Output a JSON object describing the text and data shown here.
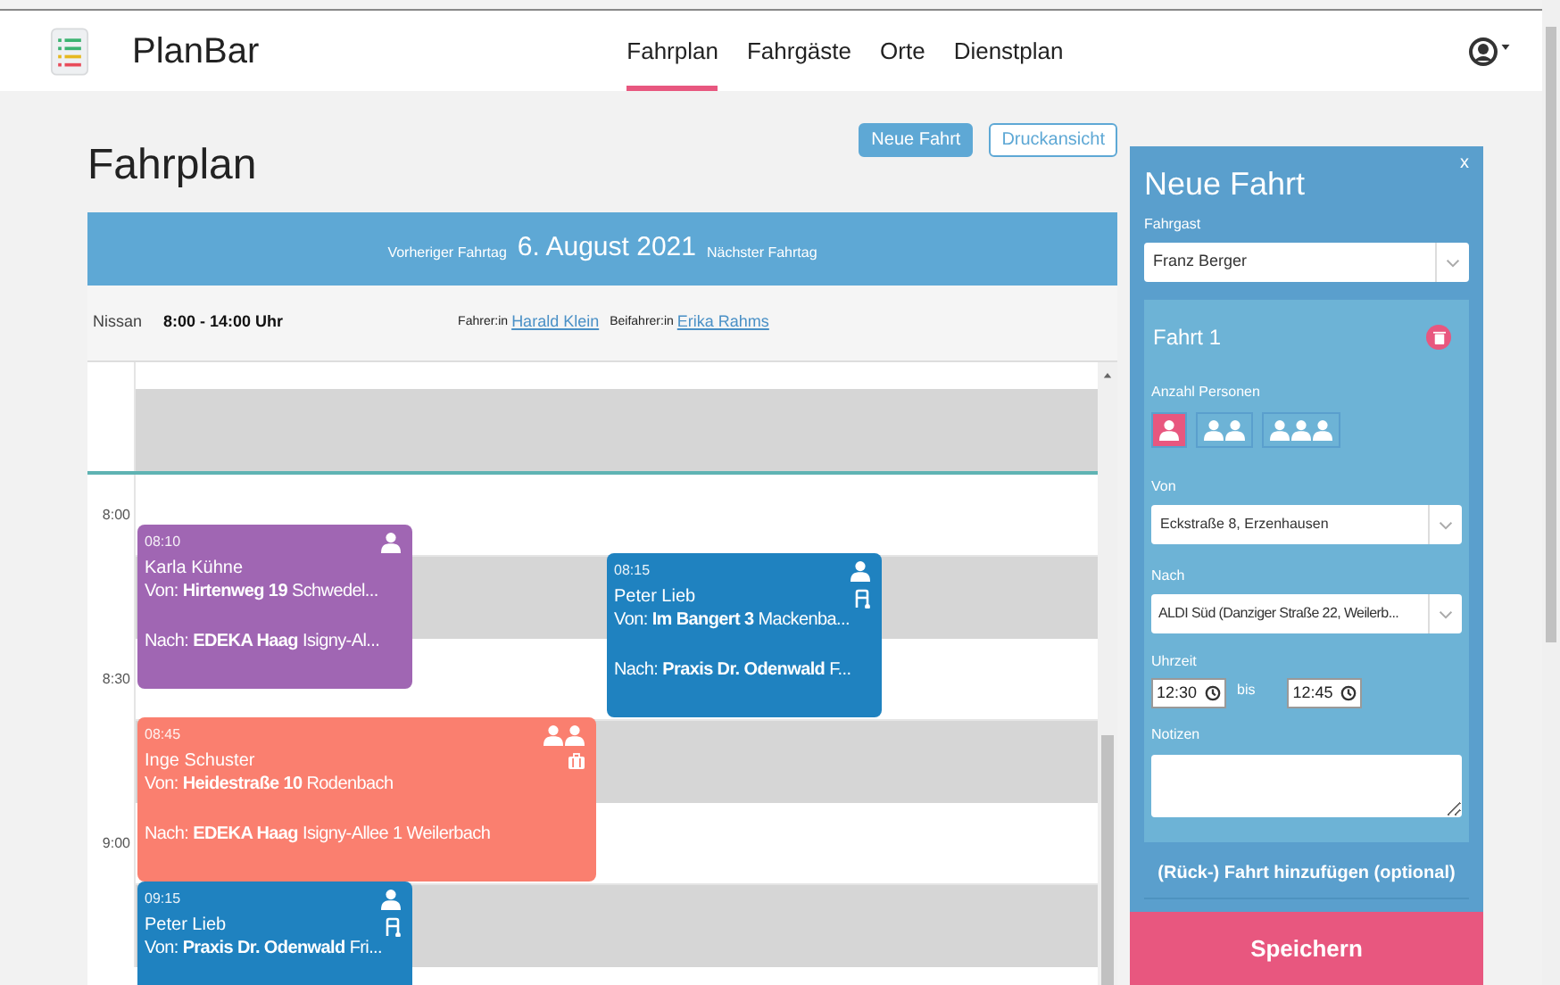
{
  "app": {
    "name": "PlanBar"
  },
  "nav": [
    {
      "label": "Fahrplan",
      "selected": true
    },
    {
      "label": "Fahrgäste",
      "selected": false
    },
    {
      "label": "Orte",
      "selected": false
    },
    {
      "label": "Dienstplan",
      "selected": false
    }
  ],
  "page": {
    "title": "Fahrplan",
    "buttons": [
      {
        "label": "Neue Fahrt",
        "kind": "primary"
      },
      {
        "label": "Druckansicht",
        "kind": "outline"
      }
    ]
  },
  "day_header": {
    "previous": "Vorheriger Fahrtag",
    "date": "6. August 2021",
    "next": "Nächster Fahrtag"
  },
  "shift": {
    "vehicle": "Nissan",
    "hours": "8:00 - 14:00 Uhr",
    "driver_label": "Fahrer:in",
    "driver": "Harald Klein",
    "codriver_label": "Beifahrer:in",
    "codriver": "Erika Rahms"
  },
  "calendar": {
    "times": [
      "8:00",
      "8:30",
      "9:00"
    ],
    "events": [
      {
        "time": "08:10",
        "passenger": "Karla Kühne",
        "from_label": "Von:",
        "from_place": "Hirtenweg 19",
        "from_rest": "Schwedel...",
        "to_label": "Nach:",
        "to_place": "EDEKA Haag",
        "to_rest": "Isigny-Al...",
        "color": "#a066b3",
        "icons": [
          {
            "kind": "person"
          }
        ]
      },
      {
        "time": "08:15",
        "passenger": "Peter Lieb",
        "from_label": "Von:",
        "from_place": "Im Bangert 3",
        "from_rest": "Mackenba...",
        "to_label": "Nach:",
        "to_place": "Praxis Dr. Odenwald",
        "to_rest": "F...",
        "color": "#1f82c0",
        "icons": [
          {
            "kind": "person"
          },
          {
            "kind": "walker"
          }
        ]
      },
      {
        "time": "08:45",
        "passenger": "Inge Schuster",
        "from_label": "Von:",
        "from_place": "Heidestraße 10",
        "from_rest": "Rodenbach",
        "to_label": "Nach:",
        "to_place": "EDEKA Haag",
        "to_rest": "Isigny-Allee 1 Weilerbach",
        "color": "#fa7f6f",
        "icons": [
          {
            "kind": "two-persons"
          },
          {
            "kind": "luggage"
          }
        ]
      },
      {
        "time": "09:15",
        "passenger": "Peter Lieb",
        "from_label": "Von:",
        "from_place": "Praxis Dr. Odenwald",
        "from_rest": "Fri...",
        "color": "#1f82c0",
        "icons": [
          {
            "kind": "person"
          },
          {
            "kind": "walker"
          }
        ]
      }
    ]
  },
  "form": {
    "title": "Neue Fahrt",
    "close": "x",
    "passenger_label": "Fahrgast",
    "passenger": "Franz Berger",
    "trip": {
      "title": "Fahrt 1",
      "persons_label": "Anzahl Personen",
      "persons_options": [
        {
          "kind": "one",
          "selected": true
        },
        {
          "kind": "two",
          "selected": false
        },
        {
          "kind": "three",
          "selected": false
        }
      ],
      "from_label": "Von",
      "from": "Eckstraße 8, Erzenhausen",
      "to_label": "Nach",
      "to": "ALDI Süd (Danziger Straße 22, Weilerb...",
      "time_label": "Uhrzeit",
      "time_from": "12:30",
      "time_sep": "bis",
      "time_to": "12:45",
      "notes_label": "Notizen"
    },
    "add_return": "(Rück-) Fahrt hinzufügen (optional)",
    "save": "Speichern"
  }
}
